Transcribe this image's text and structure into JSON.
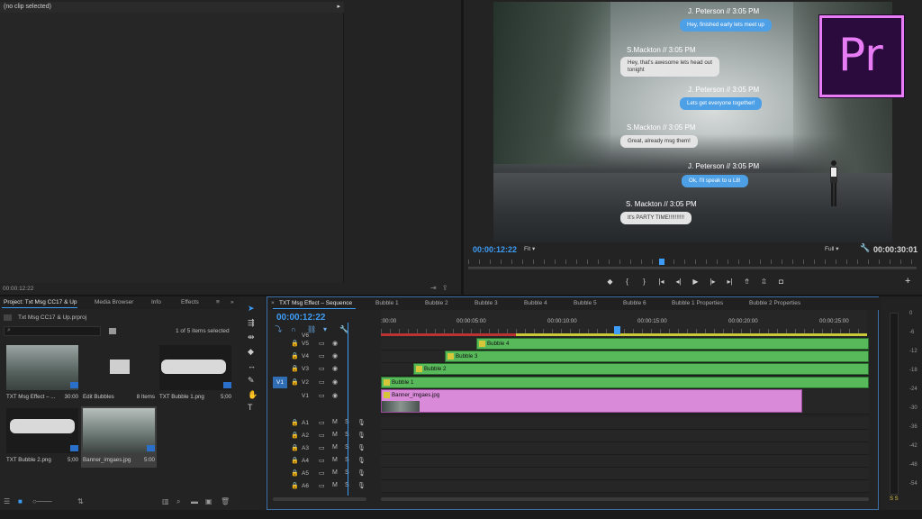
{
  "source": {
    "header": "(no clip selected)",
    "timecode": "00:00:12:22"
  },
  "program": {
    "messages": [
      {
        "name": "J. Peterson  // 3:05 PM",
        "text": "Hey, finished early lets meet up",
        "style": "blue"
      },
      {
        "name": "S.Mackton  // 3:05 PM",
        "text": "Hey, that's awesome lets head out\ntonight",
        "style": "grey"
      },
      {
        "name": "J. Peterson  // 3:05 PM",
        "text": "Lets get everyone together!",
        "style": "blue"
      },
      {
        "name": "S.Mackton  // 3:05 PM",
        "text": "Great, already msg them!",
        "style": "grey"
      },
      {
        "name": "J. Peterson  // 3:05 PM",
        "text": "Ok, I'll speak to u L8!",
        "style": "blue"
      },
      {
        "name": "S. Mackton  // 3:05 PM",
        "text": "It's PARTY TIME!!!!!!!!!!",
        "style": "grey"
      }
    ],
    "logo_text": "Pr",
    "timecode_left": "00:00:12:22",
    "fit": "Fit",
    "quality": "Full",
    "timecode_right": "00:00:30:01"
  },
  "project": {
    "tabs": [
      "Project: Txt Msg CC17 & Up",
      "Media Browser",
      "Info",
      "Effects"
    ],
    "file_name": "Txt Msg CC17 & Up.prproj",
    "search_placeholder": "",
    "item_count": "1 of 5 items selected",
    "items": [
      {
        "name": "TXT Msg Effect – ...",
        "meta": "30:00"
      },
      {
        "name": "Edit Bubbles",
        "meta": "8 Items"
      },
      {
        "name": "TXT Bubble 1.png",
        "meta": "5;00"
      },
      {
        "name": "TXT Bubble 2.png",
        "meta": "5;00"
      },
      {
        "name": "Banner_imgaes.jpg",
        "meta": "5:00"
      }
    ]
  },
  "timeline": {
    "tabs": [
      "TXT Msg Effect – Sequence",
      "Bubble 1",
      "Bubble 2",
      "Bubble 3",
      "Bubble 4",
      "Bubble 5",
      "Bubble 6",
      "Bubble 1 Properties",
      "Bubble 2 Properties"
    ],
    "timecode": "00:00:12:22",
    "ruler_labels": [
      ":00:00",
      "00:00:05:00",
      "00:00:10:00",
      "00:00:15:00",
      "00:00:20:00",
      "00:00:25:00"
    ],
    "video_tracks": [
      "V6",
      "V5",
      "V4",
      "V3",
      "V2",
      "V1"
    ],
    "audio_tracks": [
      "A1",
      "A2",
      "A3",
      "A4",
      "A5",
      "A6"
    ],
    "target_label": "V1",
    "clips": [
      "Bubble 4",
      "Bubble 3",
      "Bubble 2",
      "Bubble 1",
      "Banner_imgaes.jpg"
    ]
  },
  "meter": {
    "labels": [
      "0",
      "-6",
      "-12",
      "-18",
      "-24",
      "-30",
      "-36",
      "-42",
      "-48",
      "-54"
    ],
    "solo": "S  S"
  },
  "colors": {
    "accent": "#3d9cf5",
    "clip_green": "#58b95a",
    "clip_pink": "#d98ad9",
    "premiere_purple": "#e77cf5"
  }
}
